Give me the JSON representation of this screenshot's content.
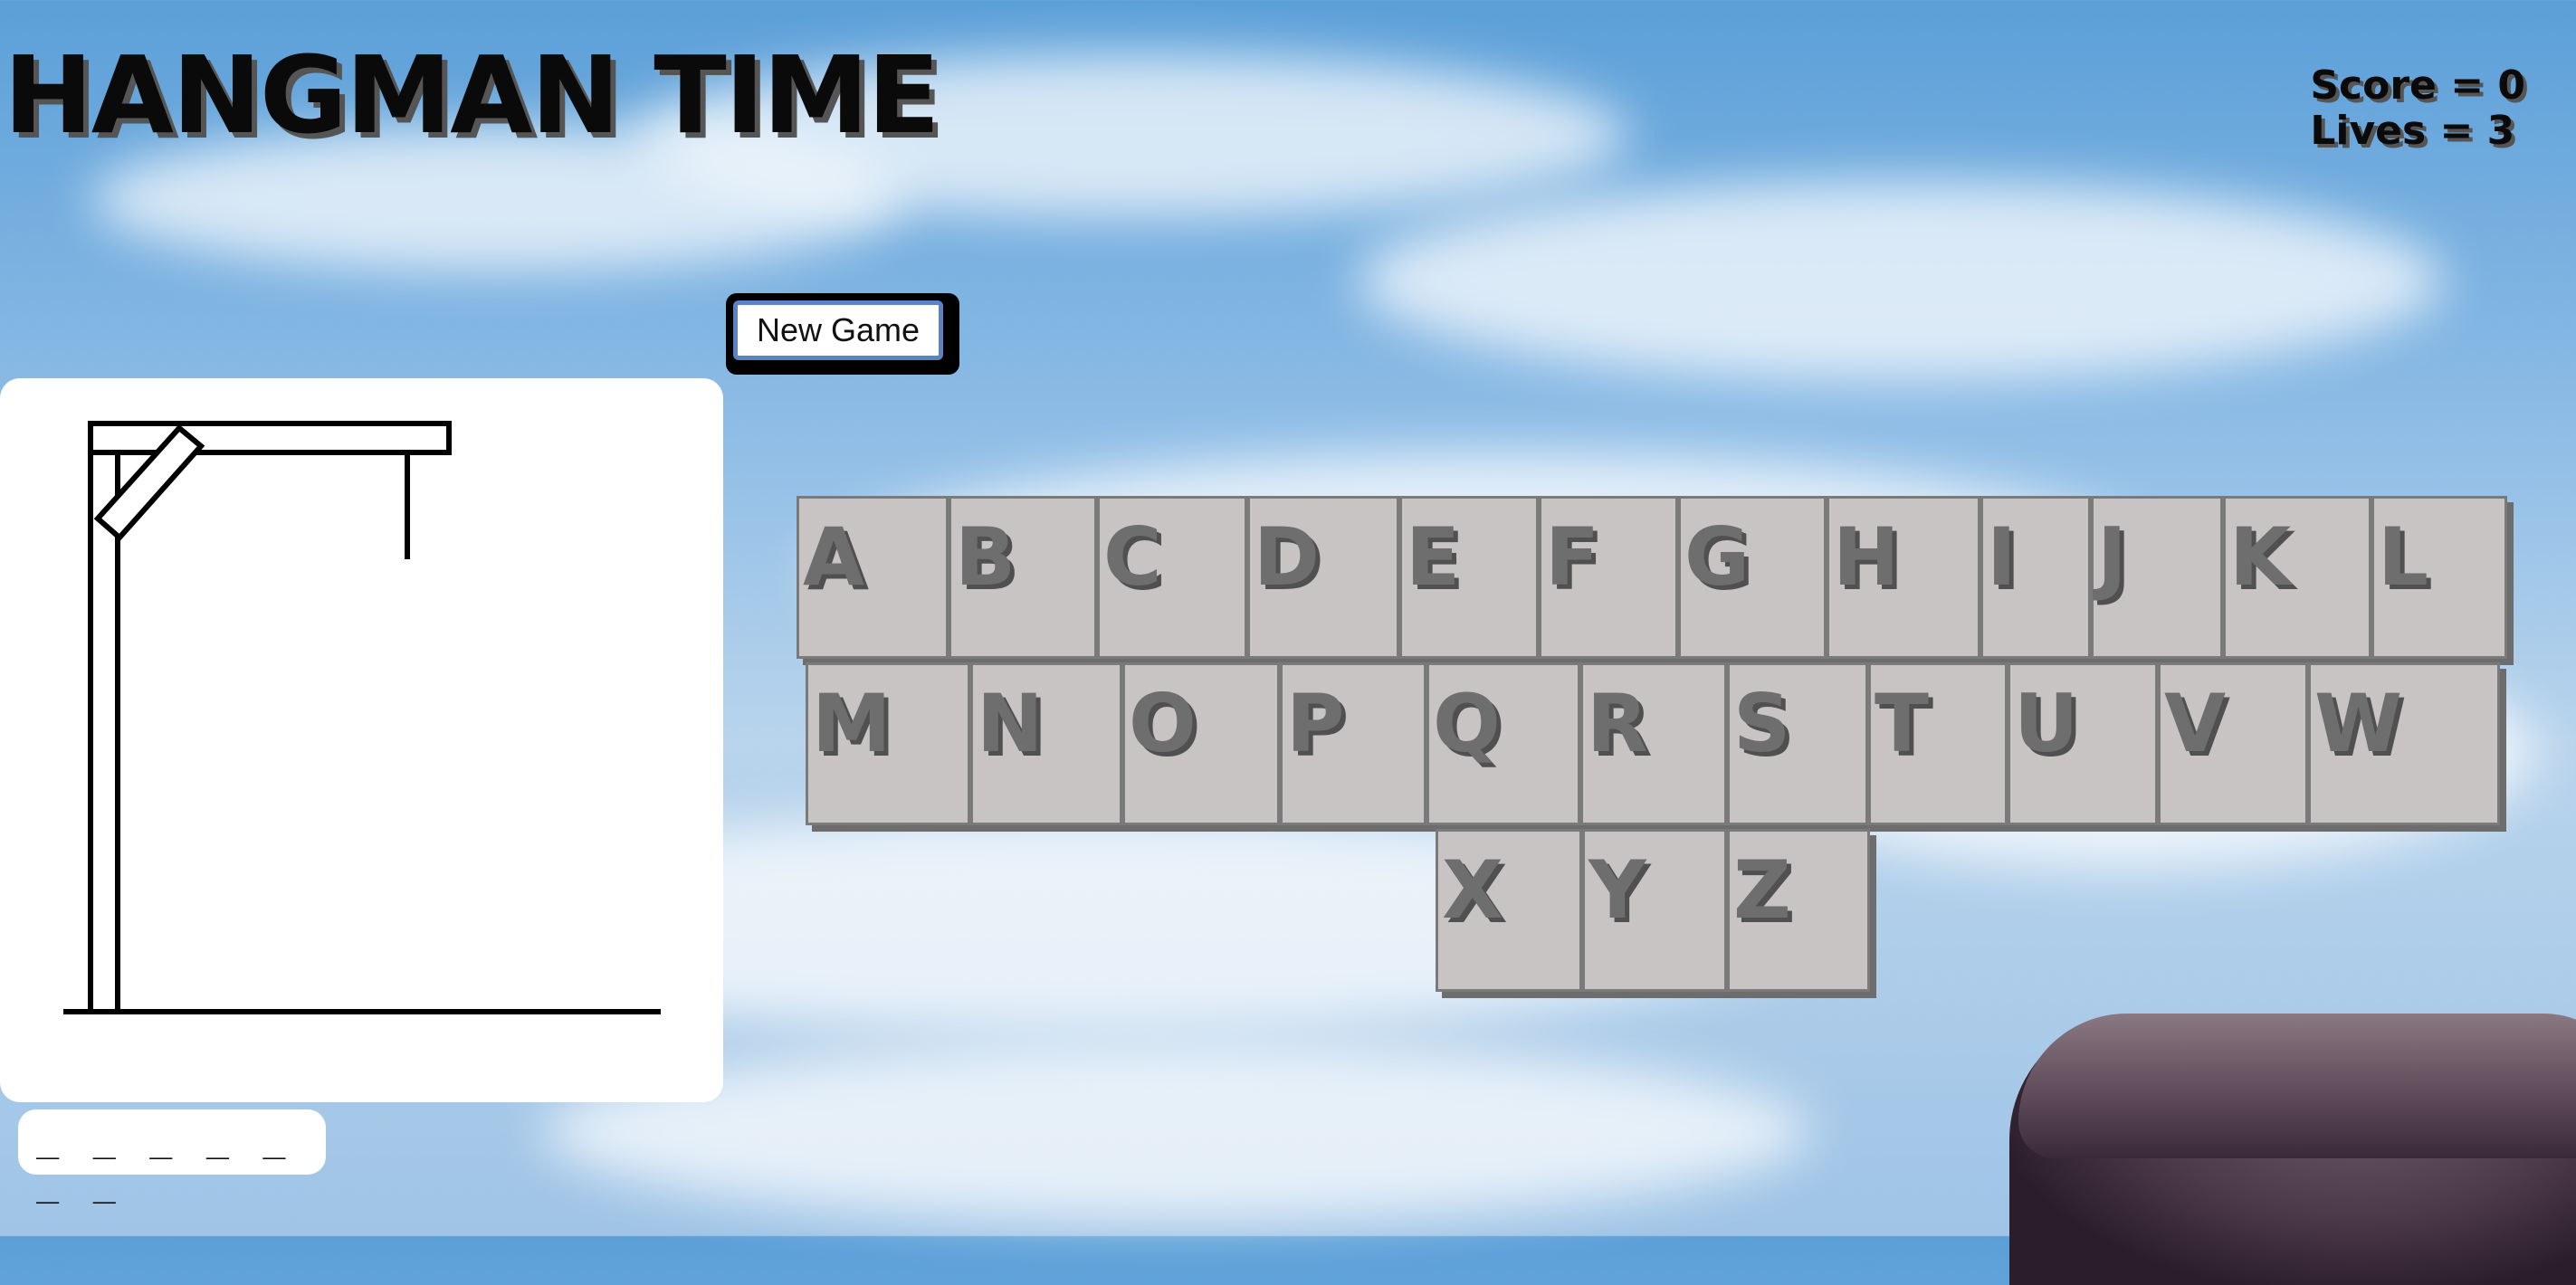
{
  "header": {
    "title": "HANGMAN TIME"
  },
  "stats": {
    "score": "Score = 0",
    "lives": "Lives = 3"
  },
  "controls": {
    "new_game": "New Game"
  },
  "word": {
    "display": "_ _ _ _ _ _ _"
  },
  "keyboard": {
    "row1": [
      "A",
      "B",
      "C",
      "D",
      "E",
      "F",
      "G",
      "H",
      "I",
      "J",
      "K",
      "L"
    ],
    "row2": [
      "M",
      "N",
      "O",
      "P",
      "Q",
      "R",
      "S",
      "T",
      "U",
      "V",
      "W"
    ],
    "row3": [
      "X",
      "Y",
      "Z"
    ]
  },
  "colors": {
    "key_bg": "#c8c4c4",
    "key_text": "#6e6e6e",
    "button_border": "#5c82c6",
    "panel_bg": "#ffffff"
  },
  "icons": {
    "gallows": "gallows-icon"
  }
}
